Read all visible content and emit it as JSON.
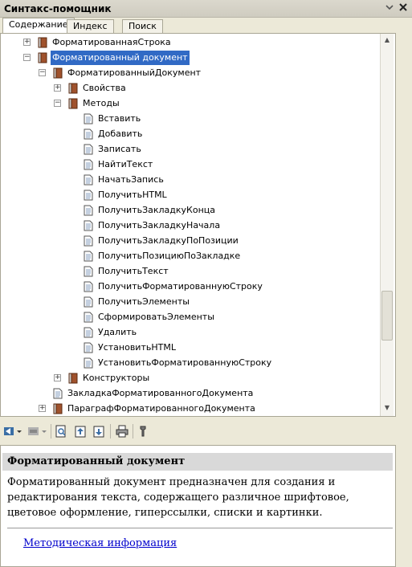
{
  "window": {
    "title": "Синтакс-помощник"
  },
  "tabs": [
    "Содержание",
    "Индекс",
    "Поиск"
  ],
  "tree": [
    {
      "label": "ФорматированнаяСтрока",
      "exp": "+",
      "icon": "book"
    },
    {
      "label": "Форматированный документ",
      "exp": "-",
      "icon": "book",
      "selected": true
    },
    {
      "label": "ФорматированныйДокумент",
      "exp": "-",
      "icon": "book"
    },
    {
      "label": "Свойства",
      "exp": "+",
      "icon": "book"
    },
    {
      "label": "Методы",
      "exp": "-",
      "icon": "book"
    },
    {
      "label": "Вставить",
      "icon": "page"
    },
    {
      "label": "Добавить",
      "icon": "page"
    },
    {
      "label": "Записать",
      "icon": "page"
    },
    {
      "label": "НайтиТекст",
      "icon": "page"
    },
    {
      "label": "НачатьЗапись",
      "icon": "page"
    },
    {
      "label": "ПолучитьHTML",
      "icon": "page"
    },
    {
      "label": "ПолучитьЗакладкуКонца",
      "icon": "page"
    },
    {
      "label": "ПолучитьЗакладкуНачала",
      "icon": "page"
    },
    {
      "label": "ПолучитьЗакладкуПоПозиции",
      "icon": "page"
    },
    {
      "label": "ПолучитьПозициюПоЗакладке",
      "icon": "page"
    },
    {
      "label": "ПолучитьТекст",
      "icon": "page"
    },
    {
      "label": "ПолучитьФорматированнуюСтроку",
      "icon": "page"
    },
    {
      "label": "ПолучитьЭлементы",
      "icon": "page"
    },
    {
      "label": "СформироватьЭлементы",
      "icon": "page"
    },
    {
      "label": "Удалить",
      "icon": "page"
    },
    {
      "label": "УстановитьHTML",
      "icon": "page"
    },
    {
      "label": "УстановитьФорматированнуюСтроку",
      "icon": "page"
    },
    {
      "label": "Конструкторы",
      "exp": "+",
      "icon": "book"
    },
    {
      "label": "ЗакладкаФорматированногоДокумента",
      "icon": "page"
    },
    {
      "label": "ПараграфФорматированногоДокумента",
      "exp": "+",
      "icon": "book"
    }
  ],
  "description": {
    "heading": "Форматированный документ",
    "text": "Форматированный документ предназначен для создания и редактирования текста, содержащего различное шрифтовое, цветовое оформление, гиперссылки, списки и картинки.",
    "link": "Методическая информация"
  },
  "colors": {
    "selection": "#316ac5",
    "link": "#0000cc",
    "book": "#a0522d"
  }
}
